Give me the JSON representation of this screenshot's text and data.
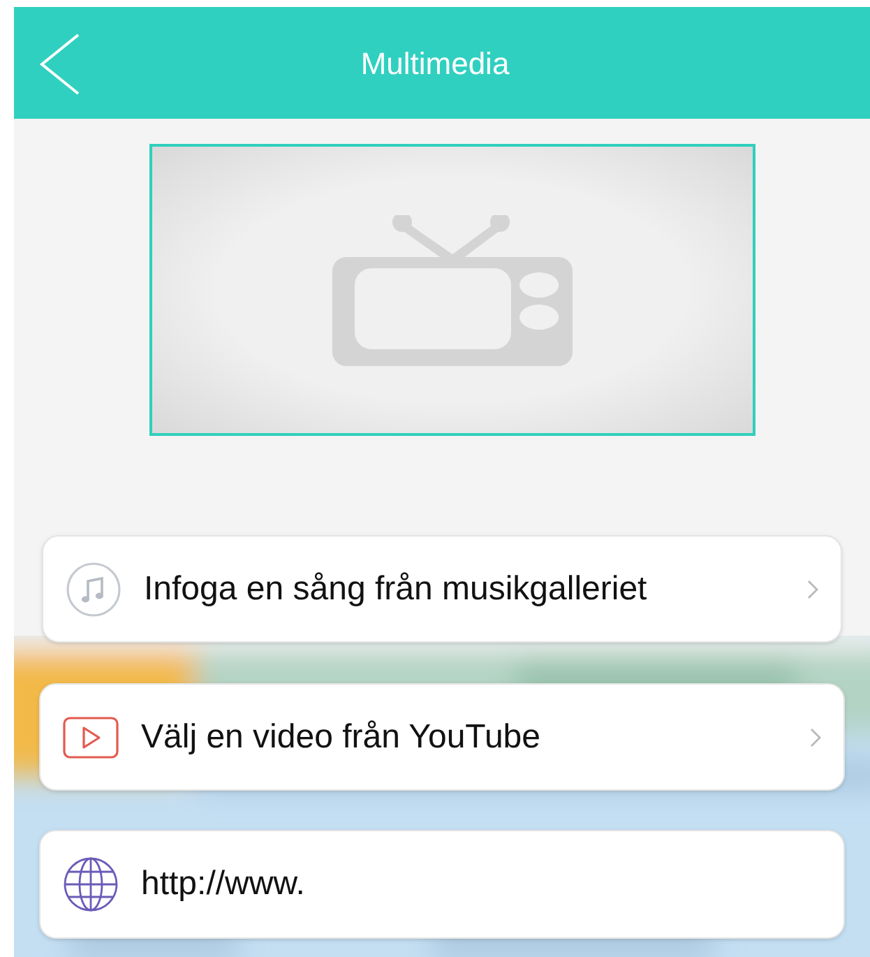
{
  "header": {
    "title": "Multimedia"
  },
  "preview": {
    "kind": "placeholder"
  },
  "options": [
    {
      "kind": "music",
      "label": "Infoga en sång från musikgalleriet",
      "chevron": true
    },
    {
      "kind": "video",
      "label": "Välj en video från YouTube",
      "chevron": true
    },
    {
      "kind": "url",
      "value": "http://www."
    }
  ]
}
